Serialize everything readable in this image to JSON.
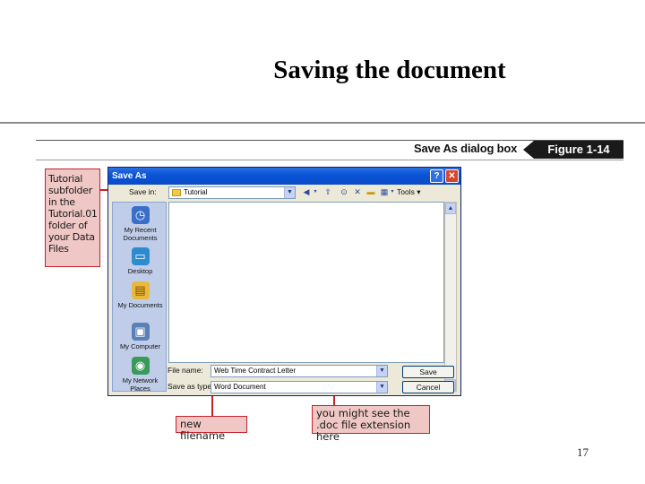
{
  "slide": {
    "title": "Saving the document",
    "page_number": "17"
  },
  "figure": {
    "caption": "Save As dialog box",
    "badge": "Figure 1-14"
  },
  "callouts": {
    "left": "Tutorial subfolder in the Tutorial.01 folder of your Data Files",
    "filename": "new filename",
    "extension": "you might see the .doc file extension here"
  },
  "dialog": {
    "title": "Save As",
    "help_button": "?",
    "close_button": "✕",
    "save_in_label": "Save in:",
    "save_in_value": "Tutorial",
    "tools_label": "Tools ▾",
    "places": [
      {
        "label": "My Recent Documents",
        "icon": "recent-documents-icon"
      },
      {
        "label": "Desktop",
        "icon": "desktop-icon"
      },
      {
        "label": "My Documents",
        "icon": "my-documents-icon"
      },
      {
        "label": "My Computer",
        "icon": "my-computer-icon"
      },
      {
        "label": "My Network Places",
        "icon": "network-places-icon"
      }
    ],
    "file_name_label": "File name:",
    "file_name_value": "Web Time Contract Letter",
    "save_as_type_label": "Save as type:",
    "save_as_type_value": "Word Document",
    "save_button": "Save",
    "cancel_button": "Cancel"
  },
  "colors": {
    "callout_fill": "#efc7c4",
    "callout_border": "#c4232b",
    "titlebar_blue": "#0b55d8"
  }
}
